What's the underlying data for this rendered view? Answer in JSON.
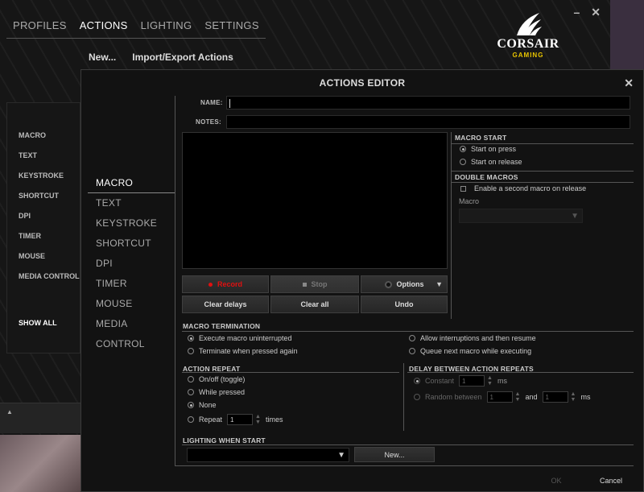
{
  "app": {
    "tabs": [
      "PROFILES",
      "ACTIONS",
      "LIGHTING",
      "SETTINGS"
    ],
    "active_tab": "ACTIONS",
    "sub_nav": {
      "new": "New...",
      "import_export": "Import/Export Actions"
    },
    "logo": {
      "brand": "CORSAIR",
      "sub": "GAMING"
    },
    "window_controls": {
      "minimize": "–",
      "close": "✕"
    },
    "bg_list": [
      "MACRO",
      "TEXT",
      "KEYSTROKE",
      "SHORTCUT",
      "DPI",
      "TIMER",
      "MOUSE",
      "MEDIA CONTROL"
    ],
    "show_all": "SHOW ALL",
    "bottom_strip_arrow": "▲"
  },
  "dialog": {
    "title": "ACTIONS EDITOR",
    "close": "✕",
    "categories": [
      "MACRO",
      "TEXT",
      "KEYSTROKE",
      "SHORTCUT",
      "DPI",
      "TIMER",
      "MOUSE",
      "MEDIA CONTROL"
    ],
    "active_category": "MACRO",
    "name_label": "NAME:",
    "name_value": "",
    "notes_label": "NOTES:",
    "notes_value": "",
    "buttons": {
      "record": "Record",
      "stop": "Stop",
      "options": "Options",
      "clear_delays": "Clear delays",
      "clear_all": "Clear all",
      "undo": "Undo"
    },
    "macro_start": {
      "title": "MACRO START",
      "options": [
        "Start on press",
        "Start on release"
      ],
      "selected": 0
    },
    "double_macros": {
      "title": "DOUBLE MACROS",
      "checkbox_label": "Enable a second macro on release",
      "checked": false,
      "macro_label": "Macro"
    },
    "macro_termination": {
      "title": "MACRO TERMINATION",
      "options": [
        "Execute macro uninterrupted",
        "Terminate when pressed again",
        "Allow interruptions and then resume",
        "Queue next macro while executing"
      ],
      "selected": 0
    },
    "action_repeat": {
      "title": "ACTION REPEAT",
      "options": [
        "On/off (toggle)",
        "While pressed",
        "None",
        "Repeat"
      ],
      "selected": 2,
      "repeat_value": "1",
      "times_label": "times"
    },
    "delay_between": {
      "title": "DELAY BETWEEN ACTION REPEATS",
      "constant_label": "Constant",
      "constant_value": "1",
      "ms": "ms",
      "random_label": "Random between",
      "random_min": "1",
      "and_label": "and",
      "random_max": "1"
    },
    "lighting": {
      "title": "LIGHTING WHEN START",
      "new_button": "New..."
    },
    "footer": {
      "ok": "OK",
      "cancel": "Cancel"
    }
  }
}
